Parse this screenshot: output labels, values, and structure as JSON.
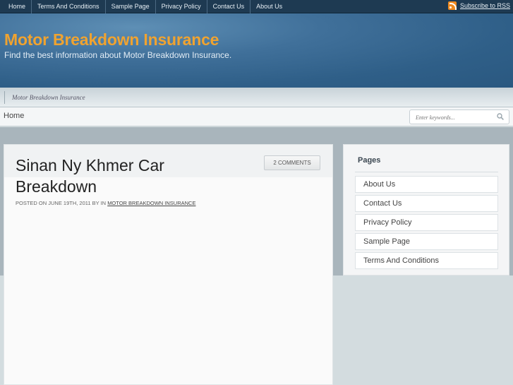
{
  "topnav": {
    "items": [
      "Home",
      "Terms And Conditions",
      "Sample Page",
      "Privacy Policy",
      "Contact Us",
      "About Us"
    ],
    "rss_label": "Subscribe to RSS"
  },
  "header": {
    "title": "Motor Breakdown Insurance",
    "description": "Find the best information about Motor Breakdown Insurance."
  },
  "breadcrumb": {
    "label": "Motor Breakdown Insurance"
  },
  "subnav": {
    "home": "Home"
  },
  "search": {
    "placeholder": "Enter keywords..."
  },
  "post": {
    "title": "Sinan Ny Khmer Car Breakdown",
    "comments": "2 COMMENTS",
    "meta_prefix": "POSTED ON JUNE 19TH, 2011 BY IN ",
    "category": "MOTOR BREAKDOWN INSURANCE"
  },
  "sidebar": {
    "title": "Pages",
    "items": [
      "About Us",
      "Contact Us",
      "Privacy Policy",
      "Sample Page",
      "Terms And Conditions"
    ]
  },
  "colors": {
    "topbar": "#1e3a52",
    "header_blue": "#2f5f88",
    "title_orange": "#f0a330",
    "rss_orange": "#ef8a20"
  }
}
